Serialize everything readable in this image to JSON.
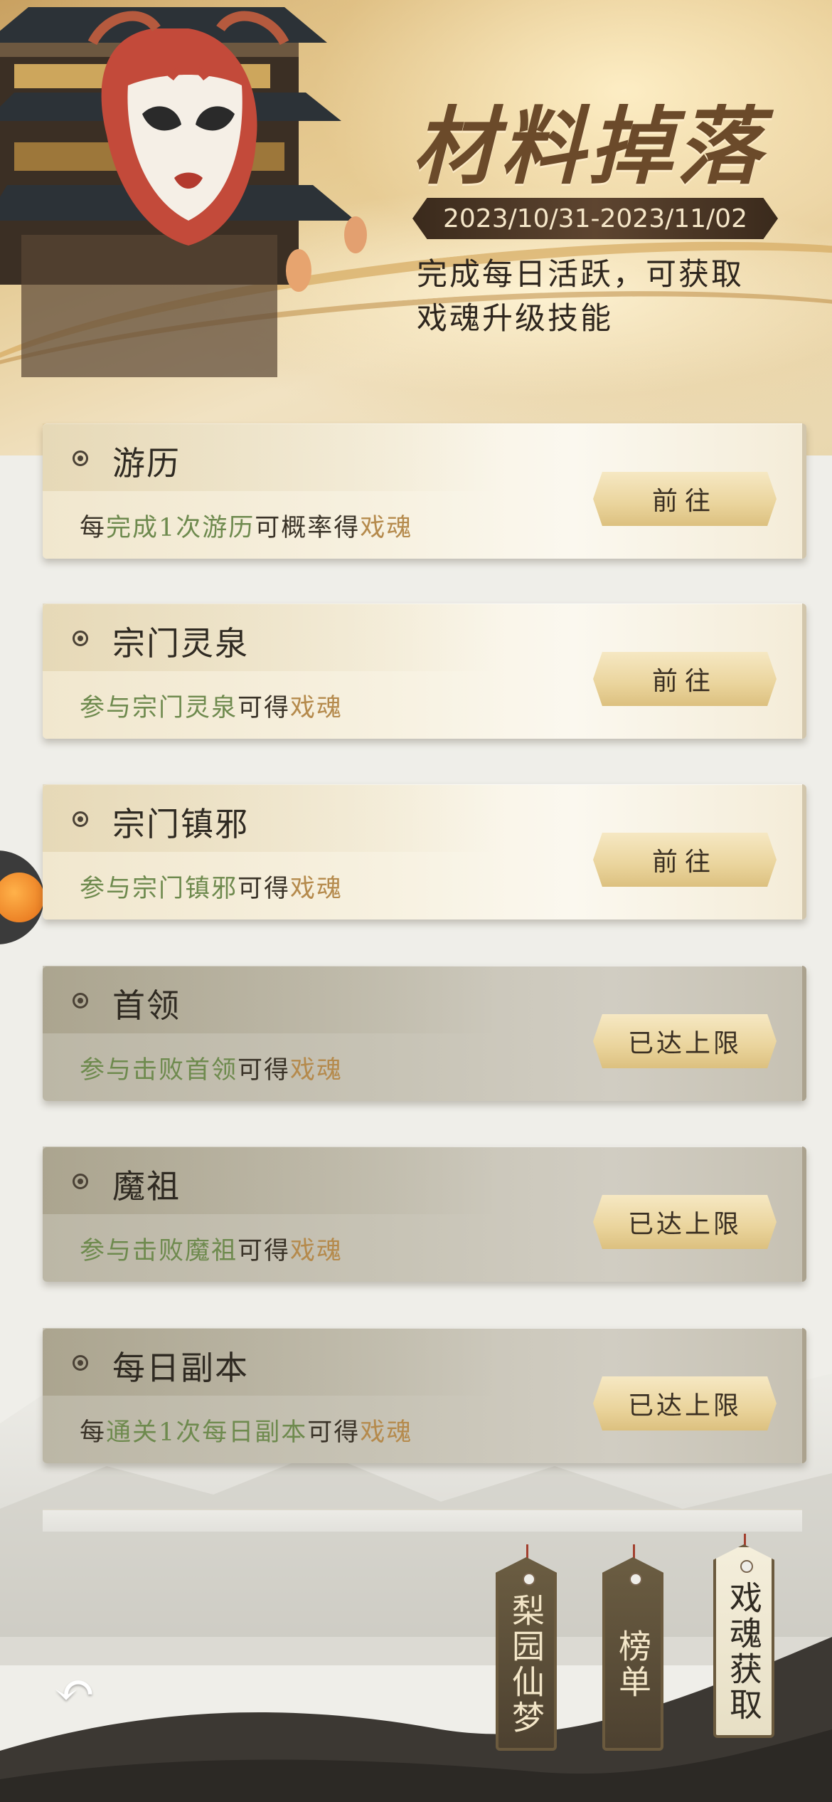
{
  "banner": {
    "title": "材料掉落",
    "date_range": "2023/10/31-2023/11/02",
    "description_line1": "完成每日活跃，可获取",
    "description_line2": "戏魂升级技能"
  },
  "tasks": [
    {
      "title": "游历",
      "desc": [
        {
          "t": "每",
          "c": "plain"
        },
        {
          "t": "完成1次游历",
          "c": "green"
        },
        {
          "t": "可概率得",
          "c": "plain"
        },
        {
          "t": "戏魂",
          "c": "gold"
        }
      ],
      "button": "前往",
      "state": "active"
    },
    {
      "title": "宗门灵泉",
      "desc": [
        {
          "t": "参与宗门灵泉",
          "c": "green"
        },
        {
          "t": "可得",
          "c": "plain"
        },
        {
          "t": "戏魂",
          "c": "gold"
        }
      ],
      "button": "前往",
      "state": "active"
    },
    {
      "title": "宗门镇邪",
      "desc": [
        {
          "t": "参与宗门镇邪",
          "c": "green"
        },
        {
          "t": "可得",
          "c": "plain"
        },
        {
          "t": "戏魂",
          "c": "gold"
        }
      ],
      "button": "前往",
      "state": "active"
    },
    {
      "title": "首领",
      "desc": [
        {
          "t": "参与击败首领",
          "c": "green"
        },
        {
          "t": "可得",
          "c": "plain"
        },
        {
          "t": "戏魂",
          "c": "gold"
        }
      ],
      "button": "已达上限",
      "state": "done"
    },
    {
      "title": "魔祖",
      "desc": [
        {
          "t": "参与击败魔祖",
          "c": "green"
        },
        {
          "t": "可得",
          "c": "plain"
        },
        {
          "t": "戏魂",
          "c": "gold"
        }
      ],
      "button": "已达上限",
      "state": "done"
    },
    {
      "title": "每日副本",
      "desc": [
        {
          "t": "每",
          "c": "plain"
        },
        {
          "t": "通关1次每日副本",
          "c": "green"
        },
        {
          "t": "可得",
          "c": "plain"
        },
        {
          "t": "戏魂",
          "c": "gold"
        }
      ],
      "button": "已达上限",
      "state": "done"
    }
  ],
  "bottom_tabs": [
    {
      "label": "梨园仙梦",
      "style": "dark"
    },
    {
      "label": "榜单",
      "style": "dark"
    },
    {
      "label": "戏魂获取",
      "style": "light"
    }
  ],
  "icons": {
    "back": "undo-arrow-icon",
    "pet": "pet-floating-icon",
    "mask": "opera-mask-icon"
  },
  "colors": {
    "green_text": "#6e8a4e",
    "gold_text": "#b58a4c"
  }
}
